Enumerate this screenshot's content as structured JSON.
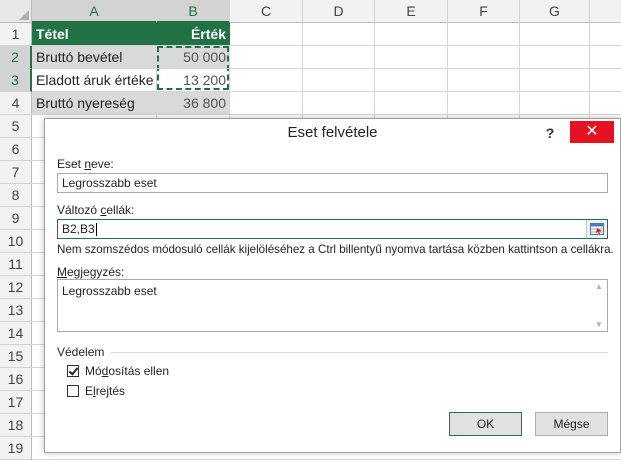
{
  "spreadsheet": {
    "columns": [
      "A",
      "B",
      "C",
      "D",
      "E",
      "F",
      "G"
    ],
    "rows": [
      "1",
      "2",
      "3",
      "4",
      "5",
      "6",
      "7",
      "8",
      "9",
      "10",
      "11",
      "12",
      "13",
      "14",
      "15",
      "16",
      "17",
      "18",
      "19"
    ],
    "header": {
      "a1": "Tétel",
      "b1": "Érték"
    },
    "data": [
      {
        "label": "Bruttó bevétel",
        "value": "50 000"
      },
      {
        "label": "Eladott áruk értéke",
        "value": "13 200"
      },
      {
        "label": "Bruttó nyereség",
        "value": "36 800"
      }
    ],
    "colors": {
      "header_bg": "#217346",
      "shade": "#d9d9d9"
    }
  },
  "dialog": {
    "title": "Eset felvétele",
    "help": "?",
    "close": "✕",
    "scenario_name_label_pre": "Eset ",
    "scenario_name_label_u": "n",
    "scenario_name_label_post": "eve:",
    "scenario_name_value": "Legrosszabb eset",
    "changing_cells_label_pre": "Változó ",
    "changing_cells_label_u": "c",
    "changing_cells_label_post": "ellák:",
    "changing_cells_value": "B2,B3",
    "hint": "Nem szomszédos módosuló cellák kijelöléséhez a Ctrl billentyű nyomva tartása közben kattintson a cellákra.",
    "comment_label_pre": "",
    "comment_label_u": "M",
    "comment_label_post": "egjegyzés:",
    "comment_value": "Legrosszabb eset",
    "protection_title": "Védelem",
    "prevent_changes_pre": "Mó",
    "prevent_changes_u": "d",
    "prevent_changes_post": "osítás ellen",
    "prevent_changes_checked": true,
    "hide_pre": "E",
    "hide_u": "l",
    "hide_post": "rejtés",
    "hide_checked": false,
    "ok_label": "OK",
    "cancel_label": "Mégse",
    "close_color": "#e81123"
  }
}
